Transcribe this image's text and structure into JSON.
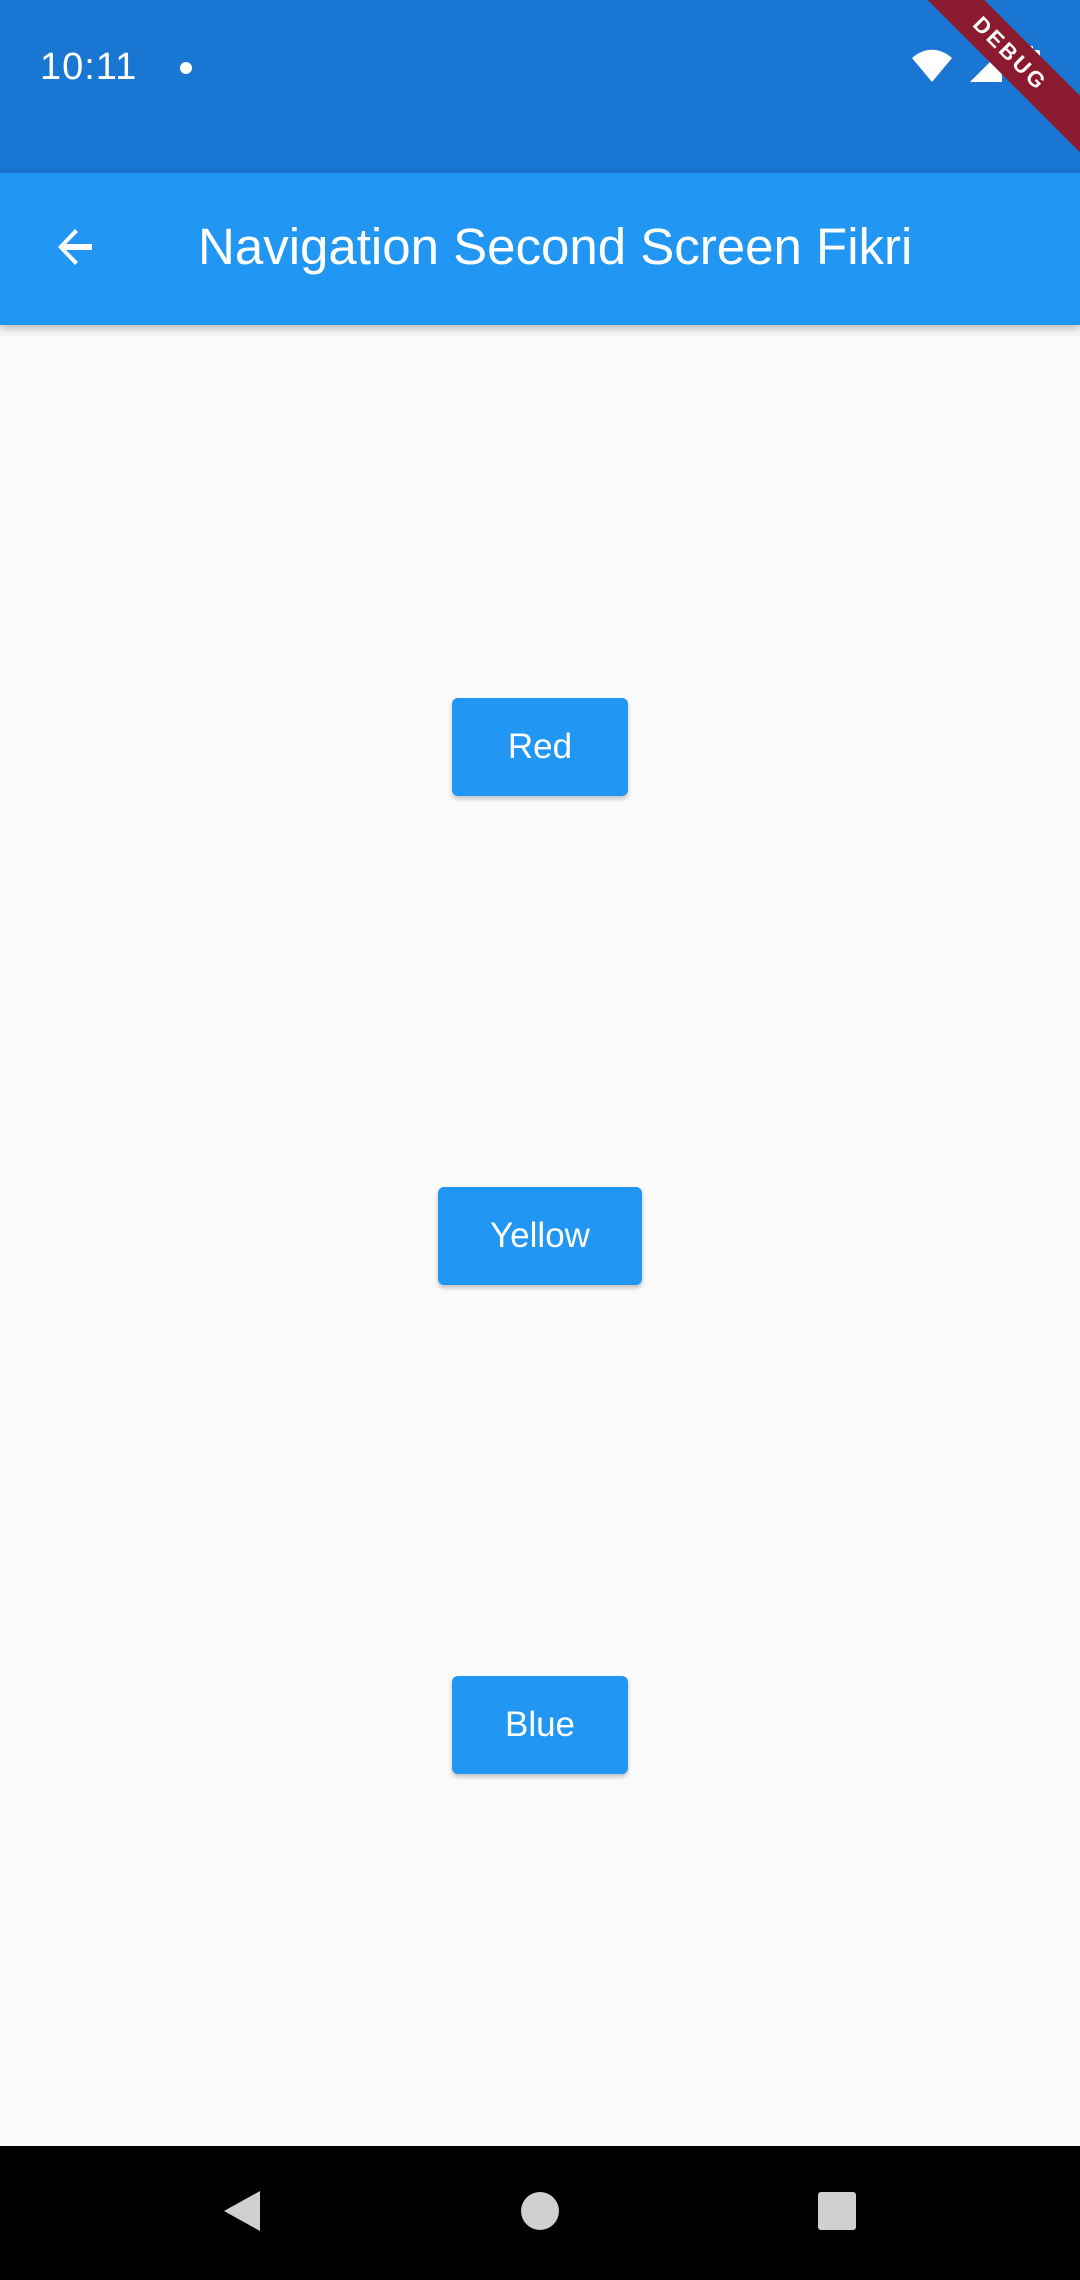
{
  "status_bar": {
    "time": "10:11",
    "debug_label": "DEBUG",
    "icons": [
      "notification-dot-icon",
      "wifi-icon",
      "signal-icon",
      "battery-icon"
    ]
  },
  "app_bar": {
    "title": "Navigation Second Screen Fikri",
    "back_icon": "arrow-back-icon"
  },
  "buttons": {
    "red": "Red",
    "yellow": "Yellow",
    "blue": "Blue"
  },
  "nav_bar": {
    "icons": [
      "nav-back-icon",
      "nav-home-icon",
      "nav-recents-icon"
    ]
  },
  "colors": {
    "status_bar": "#1976d2",
    "app_bar": "#2196f3",
    "button": "#2196f3",
    "background": "#fafafa",
    "debug_banner": "#8b1a2e"
  }
}
